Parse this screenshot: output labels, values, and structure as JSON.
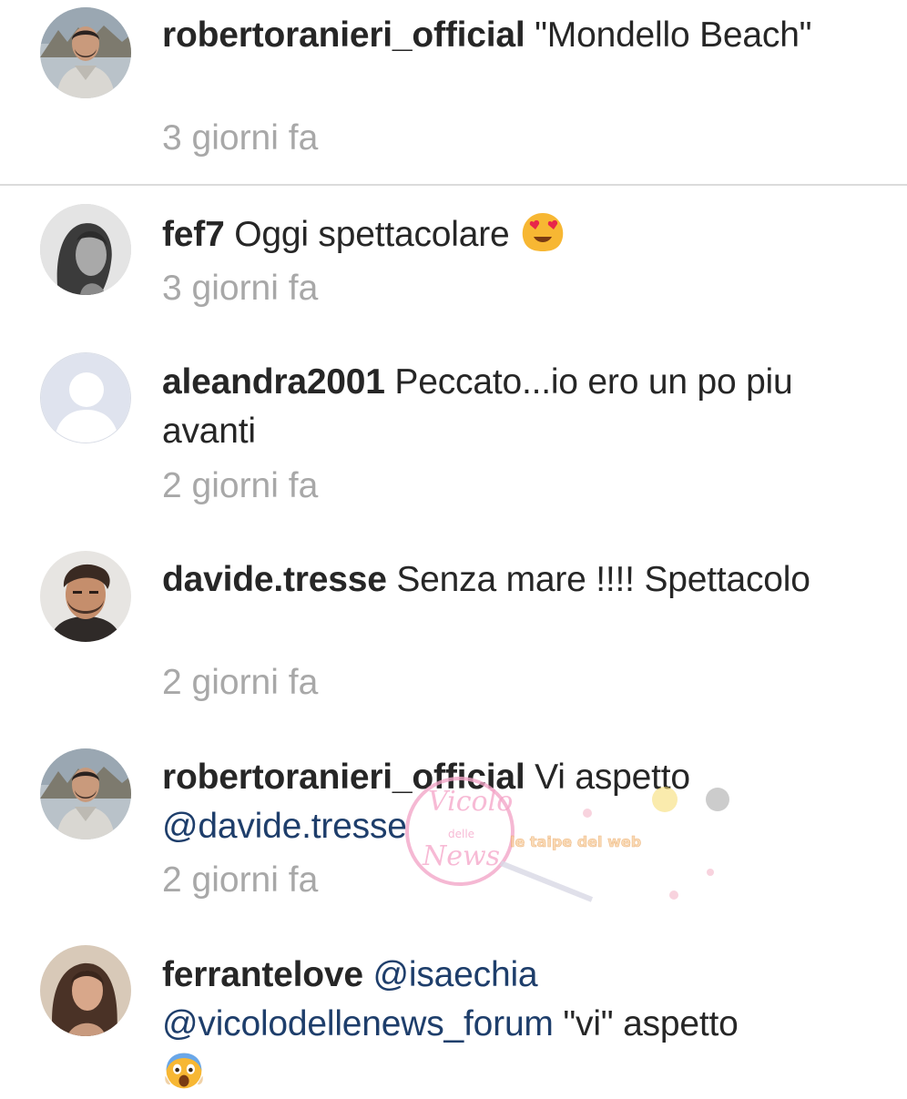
{
  "comments": [
    {
      "username": "robertoranieri_official",
      "text": "\"Mondello Beach\"",
      "mention": "",
      "time": "3 giorni fa",
      "avatar": "man-hoodie-avatar"
    },
    {
      "username": "fef7",
      "text": "Oggi spettacolare",
      "mention": "",
      "time": "3 giorni fa",
      "avatar": "woman-bw-avatar",
      "emoji": "smiling-face-heart-eyes"
    },
    {
      "username": "aleandra2001",
      "text": "Peccato...io ero un po piu avanti",
      "mention": "",
      "time": "2 giorni fa",
      "avatar": "default-person-avatar"
    },
    {
      "username": "davide.tresse",
      "text": "Senza mare !!!! Spettacolo",
      "mention": "",
      "time": "2 giorni fa",
      "avatar": "man-beard-avatar"
    },
    {
      "username": "robertoranieri_official",
      "text": "Vi aspetto",
      "mention": "@davide.tresse",
      "time": "2 giorni fa",
      "avatar": "man-hoodie-avatar"
    },
    {
      "username": "ferrantelove",
      "mention": "@isaechia",
      "mention2": "@vicolodellenews_forum",
      "text": "\"vi\" aspetto",
      "time": "",
      "avatar": "woman-longhair-avatar",
      "emoji": "face-screaming-in-fear"
    }
  ],
  "watermark": {
    "logo_text_1": "Vicolo",
    "logo_text_2": "delle",
    "logo_text_3": "News",
    "banner_text": "le taipe del web"
  },
  "colors": {
    "username": "#262626",
    "text": "#262626",
    "mention": "#1e3e6b",
    "timestamp": "#a8a8a8",
    "divider": "#dbdbdb",
    "watermark_pink": "#f5a3c7"
  }
}
